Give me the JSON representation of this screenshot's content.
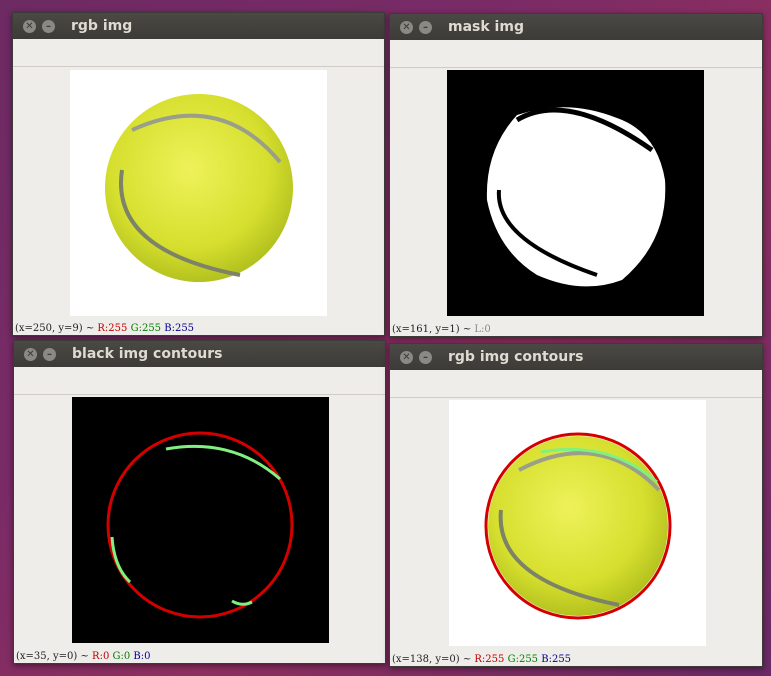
{
  "windows": [
    {
      "title": "rgb img",
      "status": {
        "coords": "(x=250, y=9) ~",
        "r": "R:255",
        "g": "G:255",
        "b": "B:255"
      }
    },
    {
      "title": "mask img",
      "status": {
        "coords": "(x=161, y=1) ~",
        "l": "L:0"
      }
    },
    {
      "title": "black img contours",
      "status": {
        "coords": "(x=35, y=0) ~",
        "r": "R:0",
        "g": "G:0",
        "b": "B:0"
      }
    },
    {
      "title": "rgb img contours",
      "status": {
        "coords": "(x=138, y=0) ~",
        "r": "R:255",
        "g": "G:255",
        "b": "B:255"
      }
    }
  ],
  "icons": {
    "close": "close-icon",
    "minimize": "minimize-icon"
  },
  "colors": {
    "ball": "#d9e234",
    "contour_circle": "#d40000",
    "contour_shape": "#80f080",
    "status_r": "#c00000",
    "status_g": "#008000",
    "status_b": "#00008b"
  }
}
